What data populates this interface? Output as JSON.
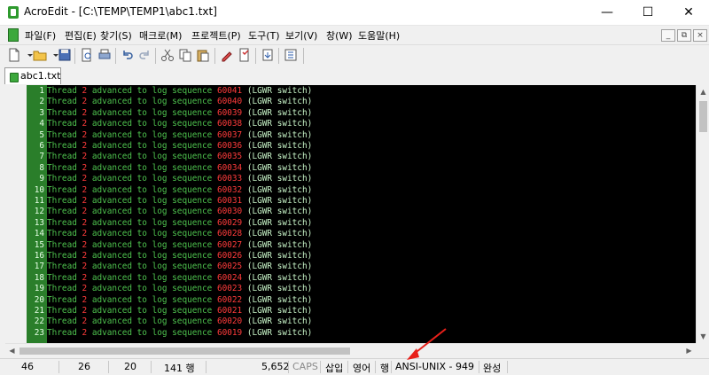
{
  "window": {
    "title": "AcroEdit - [C:\\TEMP\\TEMP1\\abc1.txt]",
    "controls": {
      "minimize": "—",
      "maximize": "☐",
      "close": "✕"
    }
  },
  "menu": {
    "items": [
      "파일(F)",
      "편집(E)",
      "찾기(S)",
      "매크로(M)",
      "프로젝트(P)",
      "도구(T)",
      "보기(V)",
      "창(W)",
      "도움말(H)"
    ],
    "mdi_controls": {
      "minimize": "_",
      "restore": "⧉",
      "close": "×"
    }
  },
  "tab": {
    "label": "abc1.txt"
  },
  "editor": {
    "lines": [
      {
        "n": "1",
        "seq": "60041"
      },
      {
        "n": "2",
        "seq": "60040"
      },
      {
        "n": "3",
        "seq": "60039"
      },
      {
        "n": "4",
        "seq": "60038"
      },
      {
        "n": "5",
        "seq": "60037"
      },
      {
        "n": "6",
        "seq": "60036"
      },
      {
        "n": "7",
        "seq": "60035"
      },
      {
        "n": "8",
        "seq": "60034"
      },
      {
        "n": "9",
        "seq": "60033"
      },
      {
        "n": "10",
        "seq": "60032"
      },
      {
        "n": "11",
        "seq": "60031"
      },
      {
        "n": "12",
        "seq": "60030"
      },
      {
        "n": "13",
        "seq": "60029"
      },
      {
        "n": "14",
        "seq": "60028"
      },
      {
        "n": "15",
        "seq": "60027"
      },
      {
        "n": "16",
        "seq": "60026"
      },
      {
        "n": "17",
        "seq": "60025"
      },
      {
        "n": "18",
        "seq": "60024"
      },
      {
        "n": "19",
        "seq": "60023"
      },
      {
        "n": "20",
        "seq": "60022"
      },
      {
        "n": "21",
        "seq": "60021"
      },
      {
        "n": "22",
        "seq": "60020"
      },
      {
        "n": "23",
        "seq": "60019"
      }
    ],
    "parts": {
      "thread": "Thread",
      "thread_no": "2",
      "middle": "advanced to log sequence",
      "suffix": "(LGWR switch)"
    },
    "colors": {
      "background": "#000000",
      "text": "#c8f5c8",
      "keyword": "#4ec34e",
      "number": "#ff3b3b",
      "line_number_bg": "#2a7e2a"
    }
  },
  "status": {
    "col": "46",
    "col2": "26",
    "col3": "20",
    "lines": "141 행",
    "size": "5,652",
    "caps": "CAPS",
    "insert": "삽입",
    "lang": "영어",
    "mode": "행",
    "encoding": "ANSI-UNIX - 949",
    "complete": "완성"
  },
  "annotation": {
    "color": "#e8201a"
  }
}
